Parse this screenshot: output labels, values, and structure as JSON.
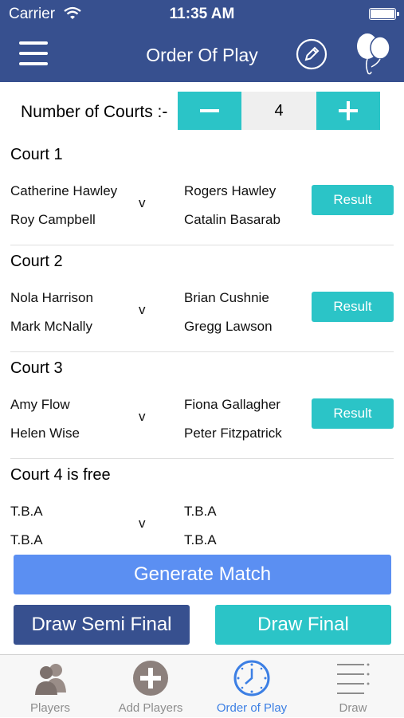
{
  "status_bar": {
    "carrier": "Carrier",
    "time": "11:35 AM"
  },
  "header": {
    "title": "Order Of Play",
    "menu_icon": "hamburger-icon",
    "edit_icon": "pencil-icon",
    "balloon_icon": "balloons-icon"
  },
  "courts_control": {
    "label": "Number of Courts :-",
    "value": "4"
  },
  "courts": [
    {
      "title": "Court 1",
      "left": [
        "Catherine Hawley",
        "Roy Campbell"
      ],
      "vs": "v",
      "right": [
        "Rogers Hawley",
        "Catalin Basarab"
      ],
      "result_label": "Result"
    },
    {
      "title": "Court 2",
      "left": [
        "Nola Harrison",
        "Mark McNally"
      ],
      "vs": "v",
      "right": [
        "Brian Cushnie",
        "Gregg Lawson"
      ],
      "result_label": "Result"
    },
    {
      "title": "Court 3",
      "left": [
        "Amy Flow",
        "Helen Wise"
      ],
      "vs": "v",
      "right": [
        "Fiona Gallagher",
        "Peter Fitzpatrick"
      ],
      "result_label": "Result"
    },
    {
      "title": "Court 4 is free",
      "left": [
        "T.B.A",
        "T.B.A"
      ],
      "vs": "v",
      "right": [
        "T.B.A",
        "T.B.A"
      ]
    }
  ],
  "actions": {
    "generate": "Generate Match",
    "semi": "Draw Semi Final",
    "final": "Draw Final"
  },
  "tabs": [
    {
      "label": "Players",
      "icon": "players-icon"
    },
    {
      "label": "Add Players",
      "icon": "add-icon"
    },
    {
      "label": "Order of Play",
      "icon": "clock-icon",
      "active": true
    },
    {
      "label": "Draw",
      "icon": "list-icon"
    }
  ],
  "colors": {
    "header": "#37508f",
    "teal": "#2bc4c7",
    "blue": "#5b8ff2",
    "active_tab": "#3c7fe4"
  }
}
